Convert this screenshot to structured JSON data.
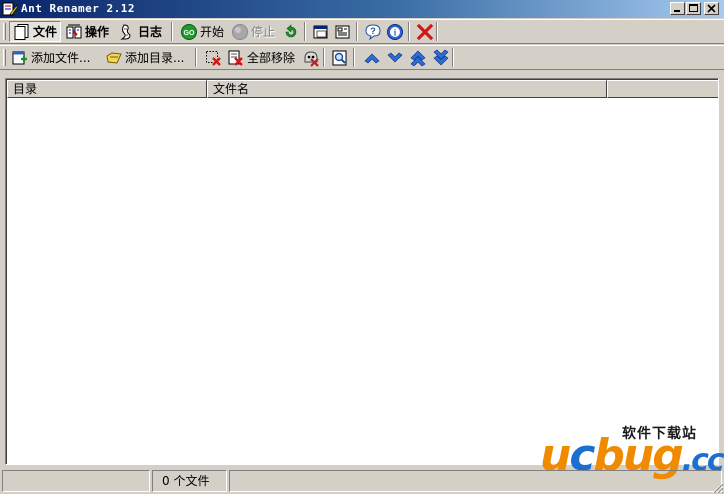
{
  "window": {
    "title": "Ant Renamer 2.12",
    "controls": [
      "minimize",
      "maximize",
      "close"
    ]
  },
  "toolbar1": {
    "tabs": [
      {
        "icon": "files-icon",
        "label": "文件",
        "active": true
      },
      {
        "icon": "actions-icon",
        "label": "操作",
        "active": false
      },
      {
        "icon": "log-icon",
        "label": "日志",
        "active": false
      }
    ],
    "start_label": "开始",
    "stop_label": "停止",
    "icons": [
      "undo-icon",
      "window-icon",
      "options-icon",
      "help-icon",
      "about-icon",
      "exit-icon"
    ]
  },
  "toolbar2": {
    "add_files_label": "添加文件...",
    "add_folders_label": "添加目录...",
    "remove_all_label": "全部移除",
    "icons": [
      "remove-selected-icon",
      "remove-all-icon",
      "remove-dead-icon",
      "preview-icon",
      "move-up-icon",
      "move-down-icon",
      "move-top-icon",
      "move-bottom-icon"
    ]
  },
  "list": {
    "columns": [
      "目录",
      "文件名"
    ],
    "rows": []
  },
  "statusbar": {
    "file_count": "0 个文件"
  },
  "watermark": {
    "slogan": "软件下载站",
    "logo": "ucbug.cc"
  },
  "colors": {
    "face": "#d4d0c8",
    "title_start": "#0a246a",
    "title_end": "#a6caf0",
    "watermark_orange": "#f08a00",
    "watermark_blue": "#1c6fd1"
  }
}
